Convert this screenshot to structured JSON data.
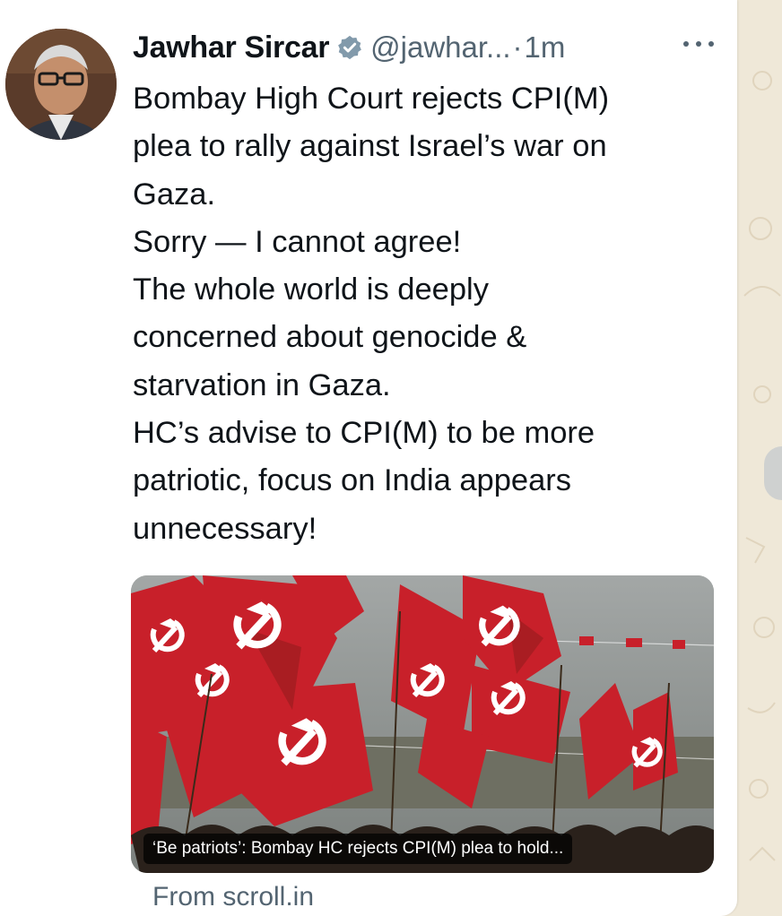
{
  "tweet": {
    "author_name": "Jawhar Sircar",
    "handle": "@jawhar...",
    "separator": "·",
    "time": "1m",
    "text_lines": [
      "Bombay High Court rejects CPI(M)",
      "plea to rally against Israel’s war on",
      "Gaza.",
      "Sorry — I cannot agree!",
      "The whole world is deeply",
      "concerned about genocide &",
      "starvation in Gaza.",
      "HC’s advise to CPI(M) to be more",
      "patriotic, focus on  India appears",
      "unnecessary!"
    ]
  },
  "link_card": {
    "caption": "‘Be patriots’: Bombay HC rejects CPI(M) plea to hold...",
    "source": "From scroll.in"
  },
  "icons": {
    "verified": "verified-badge-icon",
    "more": "more-options-icon"
  },
  "colors": {
    "wallpaper": "#efe8d8",
    "bubble": "#ffffff",
    "text": "#0f1419",
    "secondary": "#536471",
    "flag_red": "#c8202a"
  }
}
